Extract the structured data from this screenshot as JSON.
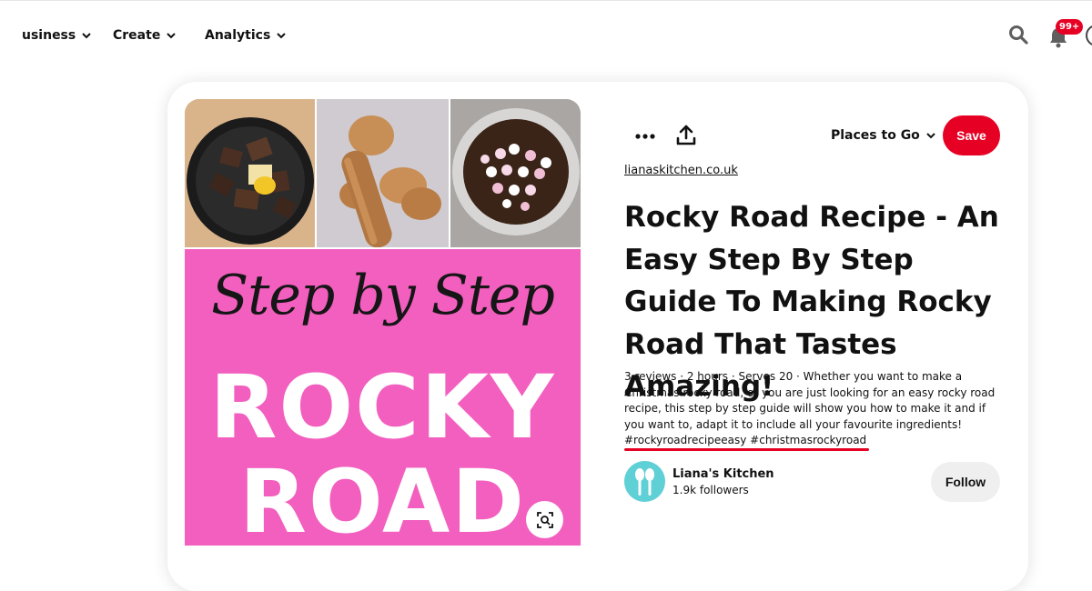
{
  "nav": {
    "items": [
      {
        "label": "usiness"
      },
      {
        "label": "Create"
      },
      {
        "label": "Analytics"
      }
    ],
    "notifications_badge": "99+",
    "icons": {
      "search": "search-icon",
      "notifications": "bell-icon"
    }
  },
  "pin": {
    "image": {
      "script_text": "Step by Step",
      "big_line1": "ROCKY",
      "big_line2": "ROAD",
      "panel_color": "#f25fbf"
    },
    "board_select": "Places to Go",
    "save_label": "Save",
    "source": "lianaskitchen.co.uk",
    "title": "Rocky Road Recipe - An Easy Step By Step Guide To Making Rocky Road That Tastes Amazing!",
    "description": "3 reviews · 2 hours · Serves 20 · Whether you want to make a Christmas rocky road, or you are just looking for an easy rocky road recipe, this step by step guide will show you how to make it and if you want to, adapt it to include all your favourite ingredients!",
    "hashtags": [
      "#rockyroadrecipeeasy",
      "#christmasrockyroad"
    ],
    "creator": {
      "name": "Liana's Kitchen",
      "followers": "1.9k followers"
    },
    "follow_label": "Follow"
  },
  "colors": {
    "accent": "#e60023",
    "follow_bg": "#efefef",
    "avatar_bg": "#5fd0d6"
  }
}
